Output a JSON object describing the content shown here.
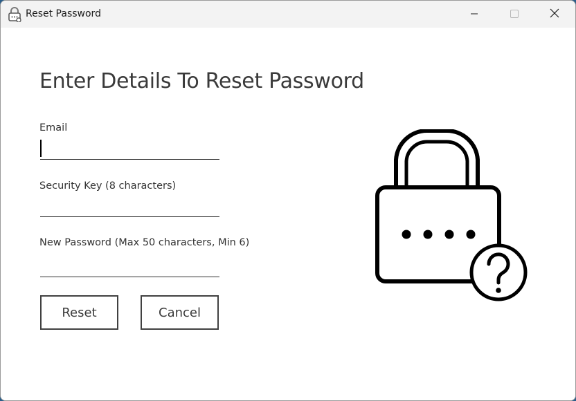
{
  "window": {
    "title": "Reset Password"
  },
  "titlebar": {
    "app_icon": "padlock-icon",
    "minimize_icon": "minimize-icon",
    "maximize_icon": "maximize-icon",
    "close_icon": "close-icon"
  },
  "form": {
    "heading": "Enter Details To Reset Password",
    "email_label": "Email",
    "email_value": "",
    "security_key_label": "Security Key (8 characters)",
    "security_key_value": "",
    "new_password_label": "New Password (Max 50 characters, Min 6)",
    "new_password_value": "",
    "reset_label": "Reset",
    "cancel_label": "Cancel"
  },
  "illustration": {
    "icon": "padlock-question-icon"
  },
  "colors": {
    "titlebar_bg": "#f3f3f3",
    "content_bg": "#ffffff",
    "text": "#3a3a3a",
    "border": "#404040"
  }
}
